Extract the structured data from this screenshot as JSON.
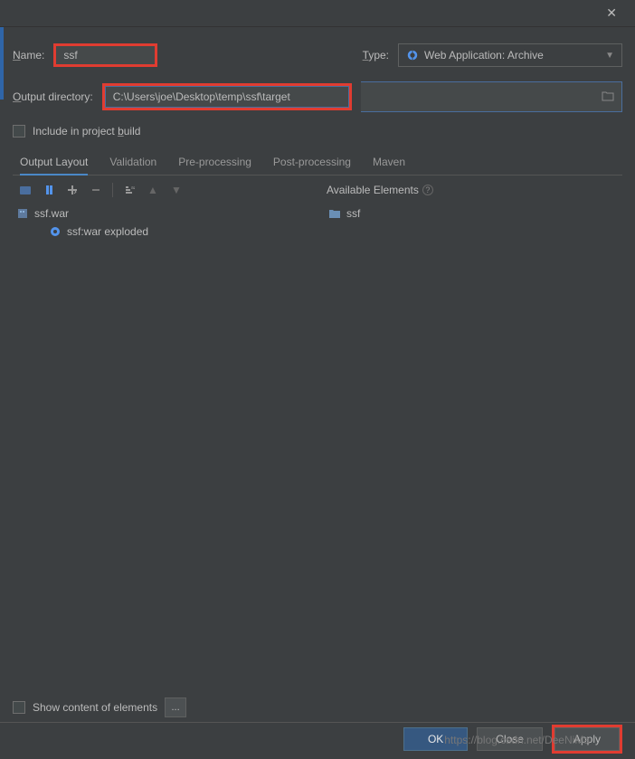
{
  "name_label": "Name:",
  "name_value": "ssf",
  "type_label": "Type:",
  "type_value": "Web Application: Archive",
  "output_label": "Output directory:",
  "output_value": "C:\\Users\\joe\\Desktop\\temp\\ssf\\target",
  "include_label": "Include in project build",
  "tabs": {
    "output_layout": "Output Layout",
    "validation": "Validation",
    "pre_processing": "Pre-processing",
    "post_processing": "Post-processing",
    "maven": "Maven"
  },
  "available_elements_label": "Available Elements",
  "tree": {
    "war": "ssf.war",
    "exploded": "ssf:war exploded",
    "available_folder": "ssf"
  },
  "show_content_label": "Show content of elements",
  "buttons": {
    "ok": "OK",
    "close": "Close",
    "apply": "Apply"
  },
  "watermark": "https://blog.csdn.net/DeeNiMa"
}
